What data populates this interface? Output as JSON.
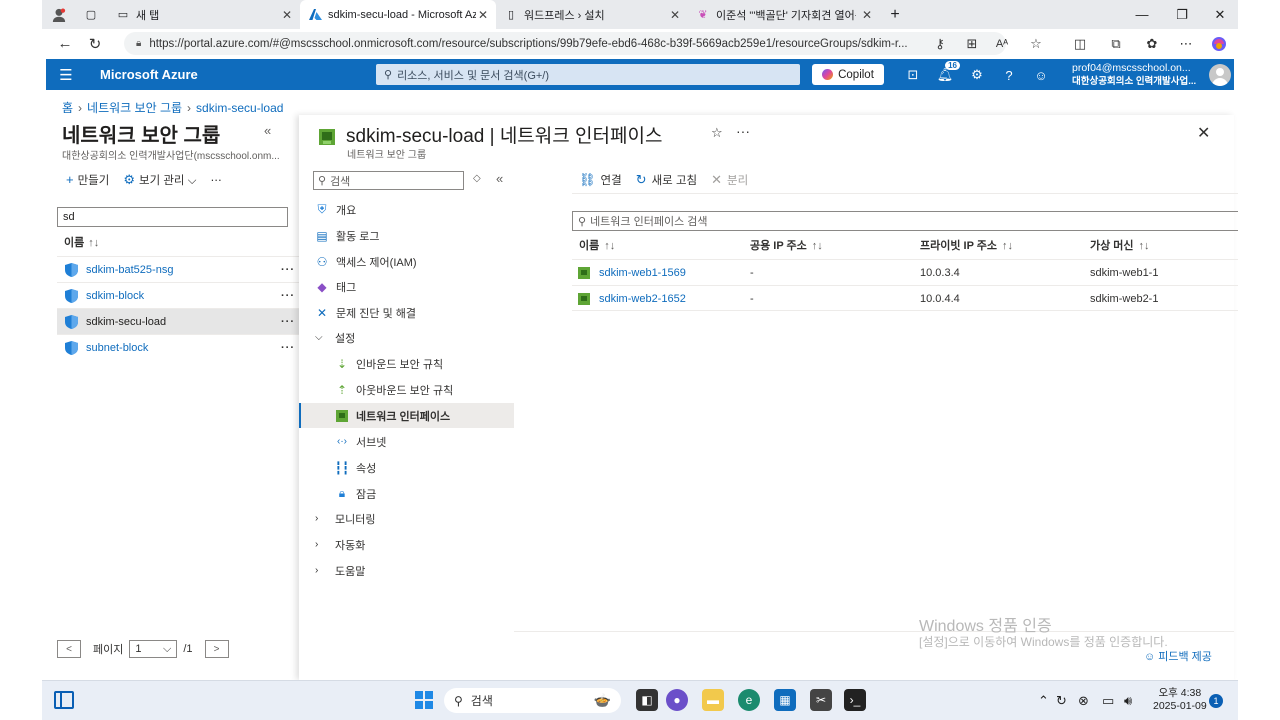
{
  "browser": {
    "tabs": [
      {
        "title": "새 탭"
      },
      {
        "title": "sdkim-secu-load - Microsoft Azure"
      },
      {
        "title": "워드프레스 › 설치"
      },
      {
        "title": "이준석 \"'백골단' 기자회견 열어준"
      }
    ],
    "url": "https://portal.azure.com/#@mscsschool.onmicrosoft.com/resource/subscriptions/99b79efe-ebd6-468c-b39f-5669acb259e1/resourceGroups/sdkim-r..."
  },
  "azure": {
    "brand": "Microsoft Azure",
    "search_placeholder": "리소스, 서비스 및 문서 검색(G+/)",
    "copilot": "Copilot",
    "notification_count": "16",
    "account_email": "prof04@mscsschool.on...",
    "account_org": "대한상공회의소 인력개발사업..."
  },
  "breadcrumb": [
    "홈",
    "네트워크 보안 그룹",
    "sdkim-secu-load"
  ],
  "left": {
    "title": "네트워크 보안 그룹",
    "subtitle": "대한상공회의소 인력개발사업단(mscsschool.onm...",
    "create": "만들기",
    "view_manage": "보기 관리",
    "filter_value": "sd",
    "col_name": "이름",
    "items": [
      {
        "name": "sdkim-bat525-nsg"
      },
      {
        "name": "sdkim-block"
      },
      {
        "name": "sdkim-secu-load"
      },
      {
        "name": "subnet-block"
      }
    ],
    "pager_label": "페이지",
    "pager_value": "1",
    "pager_total": "/1",
    "prev": "<",
    "next": ">"
  },
  "main": {
    "title": "sdkim-secu-load | 네트워크 인터페이스",
    "subtitle": "네트워크 보안 그룹",
    "menu_search": "검색",
    "menu": {
      "overview": "개요",
      "activity_log": "활동 로그",
      "iam": "액세스 제어(IAM)",
      "tags": "태그",
      "diagnose": "문제 진단 및 해결",
      "settings": "설정",
      "inbound": "인바운드 보안 규칙",
      "outbound": "아웃바운드 보안 규칙",
      "nic": "네트워크 인터페이스",
      "subnets": "서브넷",
      "properties": "속성",
      "locks": "잠금",
      "monitoring": "모니터링",
      "automation": "자동화",
      "help": "도움말"
    },
    "toolbar": {
      "connect": "연결",
      "refresh": "새로 고침",
      "disconnect": "분리"
    },
    "search_placeholder": "네트워크 인터페이스 검색",
    "columns": [
      "이름",
      "공용 IP 주소",
      "프라이빗 IP 주소",
      "가상 머신"
    ],
    "rows": [
      {
        "name": "sdkim-web1-1569",
        "public_ip": "-",
        "private_ip": "10.0.3.4",
        "vm": "sdkim-web1-1"
      },
      {
        "name": "sdkim-web2-1652",
        "public_ip": "-",
        "private_ip": "10.0.4.4",
        "vm": "sdkim-web2-1"
      }
    ],
    "feedback": "피드백 제공"
  },
  "watermark": {
    "line1": "Windows 정품 인증",
    "line2": "[설정]으로 이동하여 Windows를 정품 인증합니다."
  },
  "taskbar": {
    "search": "검색",
    "time": "오후 4:38",
    "date": "2025-01-09",
    "notifications": "1"
  },
  "colors": {
    "azure_blue": "#0f6cbd",
    "shield": "#1f7fd6",
    "nic_green": "#5ea535"
  }
}
